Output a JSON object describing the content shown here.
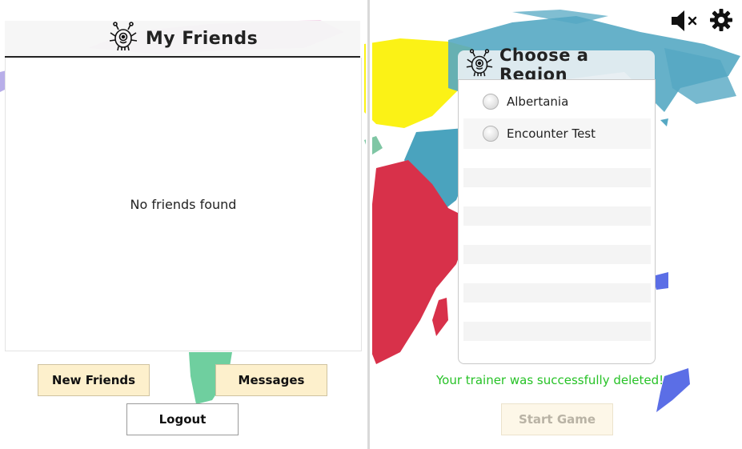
{
  "friends": {
    "title": "My Friends",
    "empty_text": "No friends found"
  },
  "buttons": {
    "new_friends": "New Friends",
    "messages": "Messages",
    "logout": "Logout",
    "start_game": "Start Game"
  },
  "region": {
    "title": "Choose a Region",
    "options": [
      {
        "label": "Albertania"
      },
      {
        "label": "Encounter Test"
      }
    ]
  },
  "status": {
    "message": "Your trainer was successfully deleted!"
  },
  "icons": {
    "mute": "mute-icon",
    "settings": "gear-icon",
    "monster": "monster-icon"
  },
  "colors": {
    "success": "#27c227",
    "button_fill": "#fdf0cc"
  }
}
